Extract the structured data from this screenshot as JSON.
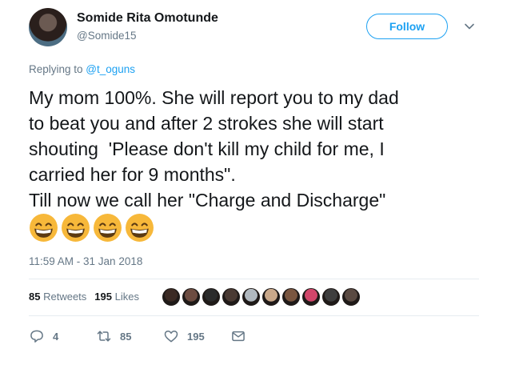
{
  "tweet": {
    "author_name": "Somide Rita Omotunde",
    "author_handle": "@Somide15",
    "follow_label": "Follow",
    "replying_prefix": "Replying to ",
    "replying_to": "@t_oguns",
    "text_lines": [
      "My mom 100%. She will report you to my dad",
      "to beat you and after 2 strokes she will start",
      "shouting  'Please don't kill my child for me, I",
      "carried her for 9 months\".",
      "Till now we call her \"Charge and Discharge\""
    ],
    "emojis": [
      "grinning-face",
      "grinning-face",
      "grinning-face",
      "grinning-face"
    ],
    "timestamp": "11:59 AM - 31 Jan 2018"
  },
  "stats": {
    "retweets_count": "85",
    "retweets_label": "Retweets",
    "likes_count": "195",
    "likes_label": "Likes",
    "liker_avatar_colors": [
      "#3b2a24",
      "#6d4c41",
      "#2b2b2b",
      "#4a3a33",
      "#b0b8bf",
      "#c9a88a",
      "#7a5640",
      "#d1466a",
      "#3e3e3e",
      "#5a4a42"
    ]
  },
  "actions": {
    "reply_count": "4",
    "retweet_count": "85",
    "like_count": "195"
  },
  "colors": {
    "accent": "#1da1f2",
    "secondary_text": "#657786",
    "primary_text": "#14171a",
    "divider": "#e6ecf0"
  }
}
